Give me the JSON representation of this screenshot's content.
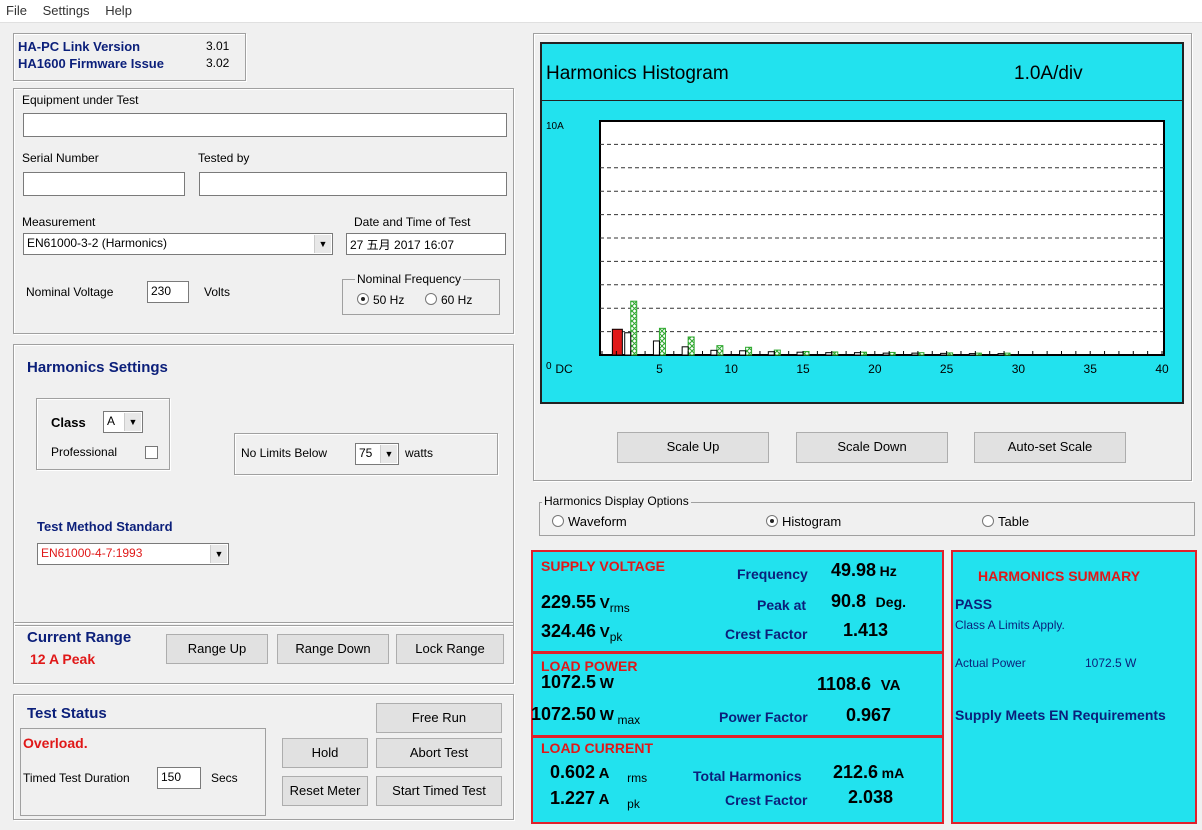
{
  "menu": {
    "file": "File",
    "settings": "Settings",
    "help": "Help"
  },
  "version": {
    "link_label": "HA-PC Link Version",
    "link_value": "3.01",
    "fw_label": "HA1600 Firmware Issue",
    "fw_value": "3.02"
  },
  "equipment": {
    "eut_label": "Equipment under Test",
    "eut_value": "",
    "serial_label": "Serial Number",
    "serial_value": "",
    "tested_by_label": "Tested by",
    "tested_by_value": "",
    "measurement_label": "Measurement",
    "measurement_value": "EN61000-3-2 (Harmonics)",
    "datetime_label": "Date and Time of Test",
    "datetime_value": "27 五月 2017  16:07",
    "nominal_voltage_label": "Nominal Voltage",
    "nominal_voltage_value": "230",
    "volts_label": "Volts",
    "nominal_freq_label": "Nominal Frequency",
    "freq_50": "50 Hz",
    "freq_60": "60 Hz"
  },
  "harmonics_settings": {
    "title": "Harmonics Settings",
    "class_label": "Class",
    "class_value": "A",
    "professional_label": "Professional",
    "no_limits_label": "No Limits Below",
    "no_limits_value": "75",
    "watts_label": "watts",
    "test_method_label": "Test Method Standard",
    "test_method_value": "EN61000-4-7:1993"
  },
  "current_range": {
    "title": "Current Range",
    "value": "12 A Peak",
    "range_up": "Range Up",
    "range_down": "Range Down",
    "lock_range": "Lock Range"
  },
  "test_status": {
    "title": "Test Status",
    "status": "Overload.",
    "duration_label": "Timed Test Duration",
    "duration_value": "150",
    "secs_label": "Secs",
    "free_run": "Free Run",
    "hold": "Hold",
    "abort_test": "Abort Test",
    "reset_meter": "Reset Meter",
    "start_timed_test": "Start Timed Test"
  },
  "histogram": {
    "title": "Harmonics Histogram",
    "scale": "1.0A/div",
    "scale_up": "Scale Up",
    "scale_down": "Scale Down",
    "auto_scale": "Auto-set Scale"
  },
  "display_options": {
    "title": "Harmonics Display Options",
    "waveform": "Waveform",
    "histogram": "Histogram",
    "table": "Table"
  },
  "supply": {
    "title": "SUPPLY VOLTAGE",
    "vrms": "229.55",
    "vrms_unit": "V",
    "vrms_sub": "rms",
    "vpk": "324.46",
    "vpk_unit": "V",
    "vpk_sub": "pk",
    "freq_label": "Frequency",
    "freq_value": "49.98",
    "freq_unit": "Hz",
    "peak_label": "Peak at",
    "peak_value": "90.8",
    "peak_unit": "Deg.",
    "crest_label": "Crest Factor",
    "crest_value": "1.413"
  },
  "load_power": {
    "title": "LOAD POWER",
    "w": "1072.5",
    "w_unit": "W",
    "va": "1108.6",
    "va_unit": "VA",
    "wmax": "1072.50",
    "wmax_unit": "W",
    "wmax_sub": "max",
    "pf_label": "Power Factor",
    "pf_value": "0.967"
  },
  "load_current": {
    "title": "LOAD CURRENT",
    "arms": "0.602",
    "arms_unit": "A",
    "arms_sub": "rms",
    "apk": "1.227",
    "apk_unit": "A",
    "apk_sub": "pk",
    "th_label": "Total Harmonics",
    "th_value": "212.6",
    "th_unit": "mA",
    "crest_label": "Crest Factor",
    "crest_value": "2.038"
  },
  "summary": {
    "title": "HARMONICS SUMMARY",
    "result": "PASS",
    "class_note": "Class A  Limits Apply.",
    "power_label": "Actual Power",
    "power_value": "1072.5 W",
    "meets": "Supply Meets EN Requirements"
  },
  "colors": {
    "panel_cyan": "#22e2ee",
    "bar_red": "#e01818",
    "limit_green": "#2ea82e",
    "title_navy": "#0b1f7a"
  },
  "chart_data": {
    "type": "bar",
    "title": "Harmonics Histogram",
    "scale_label": "1.0A/div",
    "ylim": [
      0,
      10
    ],
    "y_tick_labels": [
      "0",
      "10A"
    ],
    "xlim": [
      1,
      40
    ],
    "x_tick_labels": [
      "DC",
      "5",
      "10",
      "15",
      "20",
      "25",
      "30",
      "35",
      "40"
    ],
    "x_ticks": [
      1,
      5,
      10,
      15,
      20,
      25,
      30,
      35,
      40
    ],
    "grid": true,
    "series": [
      {
        "values": [
          {
            "h": 2,
            "v": 1.1
          },
          {
            "h": 3,
            "v": 0.95
          },
          {
            "h": 5,
            "v": 0.6
          },
          {
            "h": 7,
            "v": 0.35
          },
          {
            "h": 9,
            "v": 0.2
          },
          {
            "h": 11,
            "v": 0.18
          },
          {
            "h": 13,
            "v": 0.14
          },
          {
            "h": 15,
            "v": 0.12
          },
          {
            "h": 17,
            "v": 0.1
          },
          {
            "h": 19,
            "v": 0.1
          },
          {
            "h": 21,
            "v": 0.08
          },
          {
            "h": 23,
            "v": 0.08
          },
          {
            "h": 25,
            "v": 0.07
          },
          {
            "h": 27,
            "v": 0.06
          },
          {
            "h": 29,
            "v": 0.06
          }
        ]
      },
      {
        "values": [
          {
            "h": 3,
            "v": 2.3
          },
          {
            "h": 5,
            "v": 1.14
          },
          {
            "h": 7,
            "v": 0.77
          },
          {
            "h": 9,
            "v": 0.4
          },
          {
            "h": 11,
            "v": 0.33
          },
          {
            "h": 13,
            "v": 0.21
          },
          {
            "h": 15,
            "v": 0.15
          },
          {
            "h": 17,
            "v": 0.13
          },
          {
            "h": 19,
            "v": 0.12
          },
          {
            "h": 21,
            "v": 0.11
          },
          {
            "h": 23,
            "v": 0.1
          },
          {
            "h": 25,
            "v": 0.09
          },
          {
            "h": 27,
            "v": 0.08
          },
          {
            "h": 29,
            "v": 0.08
          }
        ]
      }
    ]
  }
}
